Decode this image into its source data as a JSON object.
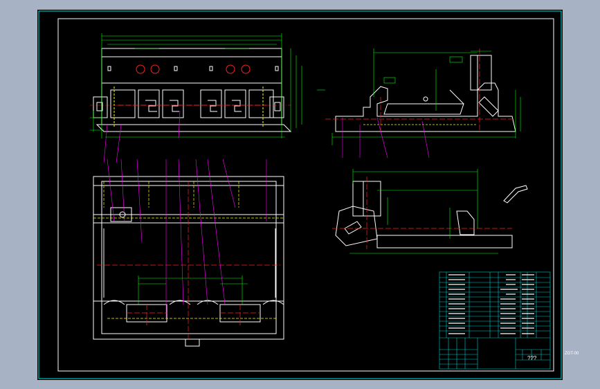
{
  "drawing": {
    "title_block": {
      "center_label": "???",
      "drawing_code": "ZGT-00"
    },
    "colors": {
      "background": "#000000",
      "border": "#ffffff",
      "inner_frame": "#00e5e5",
      "outline_white": "#ffffff",
      "dimension": "#00ff00",
      "center_line": "#ff2020",
      "hidden_line": "#ffff00",
      "leader": "#ff00ff",
      "bom_grid": "#00c8c8",
      "viewport_bg": "#a7b3c4"
    },
    "views": [
      "front-view",
      "side-view",
      "plan-view",
      "section-view",
      "detail-view",
      "bom-table"
    ]
  }
}
